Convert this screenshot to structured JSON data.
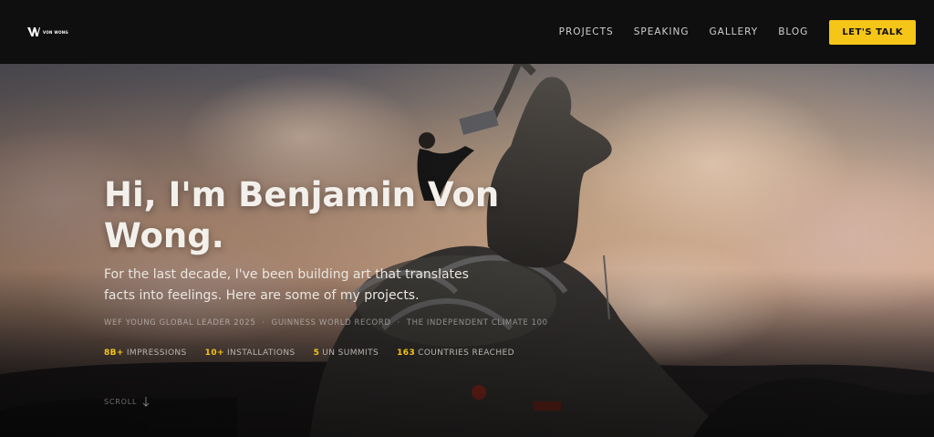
{
  "header": {
    "logo_text": "VON WONG",
    "nav": [
      "PROJECTS",
      "SPEAKING",
      "GALLERY",
      "BLOG"
    ],
    "cta_label": "LET'S TALK",
    "cta_color": "#f5c518"
  },
  "hero": {
    "title": "Hi, I'm Benjamin Von Wong.",
    "subtitle": "For the last decade, I've been building art that translates facts into feelings. Here are some of my projects.",
    "awards": [
      "WEF YOUNG GLOBAL LEADER 2025",
      "GUINNESS WORLD RECORD",
      "THE INDEPENDENT CLIMATE 100"
    ],
    "award_separator": "·",
    "stats": [
      {
        "num": "8B+",
        "label": "IMPRESSIONS"
      },
      {
        "num": "10+",
        "label": "INSTALLATIONS"
      },
      {
        "num": "5",
        "label": "UN SUMMITS"
      },
      {
        "num": "163",
        "label": "COUNTRIES REACHED"
      }
    ],
    "scroll_label": "SCROLL",
    "accent_color": "#f5c518"
  }
}
